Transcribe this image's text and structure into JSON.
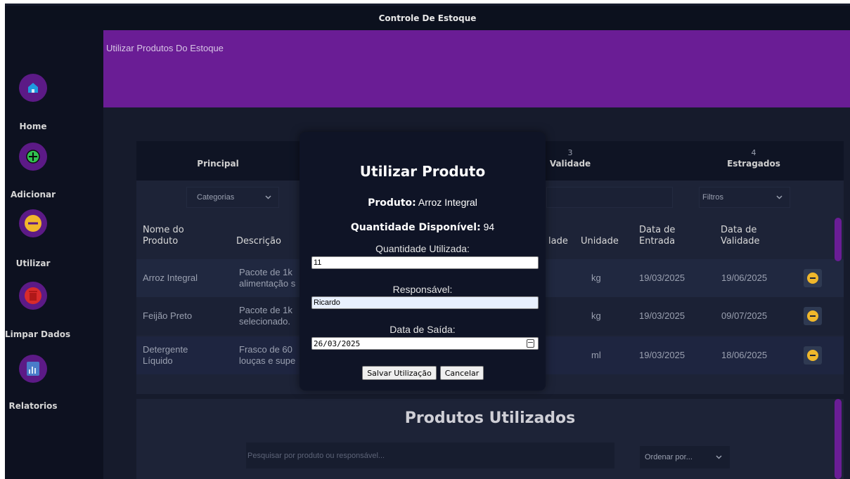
{
  "top_partial_headers": [
    "Produto",
    "Quantidade Utilizada",
    "Responsável",
    "Data de Saída"
  ],
  "app": {
    "title": "Controle De Estoque"
  },
  "sidebar": {
    "items": [
      {
        "label": "Home",
        "icon": "home-icon"
      },
      {
        "label": "Adicionar",
        "icon": "plus-icon"
      },
      {
        "label": "Utilizar",
        "icon": "minus-icon"
      },
      {
        "label": "Limpar Dados",
        "icon": "trash-icon"
      },
      {
        "label": "Relatorios",
        "icon": "report-icon"
      }
    ]
  },
  "banner": {
    "title": "Utilizar Produtos Do Estoque"
  },
  "tabs": [
    {
      "num": "",
      "name": "Principal"
    },
    {
      "num": "3",
      "name": "Validade"
    },
    {
      "num": "4",
      "name": "Estragados"
    }
  ],
  "filters": {
    "categorias": "Categorias",
    "filtros": "Filtros"
  },
  "table": {
    "headers": {
      "nome": "Nome do Produto",
      "descricao": "Descrição",
      "quantidade_partial": "lade",
      "unidade": "Unidade",
      "entrada": "Data de Entrada",
      "validade": "Data de Validade"
    },
    "rows": [
      {
        "nome": "Arroz Integral",
        "descricao": "Pacote de 1k alimentação s",
        "unidade": "kg",
        "entrada": "19/03/2025",
        "validade": "19/06/2025"
      },
      {
        "nome": "Feijão Preto",
        "descricao": "Pacote de 1k selecionado.",
        "unidade": "kg",
        "entrada": "19/03/2025",
        "validade": "09/07/2025"
      },
      {
        "nome": "Detergente Líquido",
        "descricao": "Frasco de 60 louças e supe",
        "unidade": "ml",
        "entrada": "19/03/2025",
        "validade": "18/06/2025"
      }
    ]
  },
  "used": {
    "title": "Produtos Utilizados",
    "search_placeholder": "Pesquisar por produto ou responsável...",
    "order_label": "Ordenar por..."
  },
  "modal": {
    "title": "Utilizar Produto",
    "produto_label": "Produto:",
    "produto_value": "Arroz Integral",
    "qtd_disp_label": "Quantidade Disponível:",
    "qtd_disp_value": "94",
    "qtd_util_label": "Quantidade Utilizada:",
    "qtd_util_value": "11",
    "responsavel_label": "Responsável:",
    "responsavel_value": "Ricardo",
    "data_saida_label": "Data de Saída:",
    "data_saida_value": "26/03/2025",
    "save_label": "Salvar Utilização",
    "cancel_label": "Cancelar"
  },
  "colors": {
    "accent": "#6a1d95",
    "warning": "#f0b72b",
    "background": "#161b2c"
  }
}
